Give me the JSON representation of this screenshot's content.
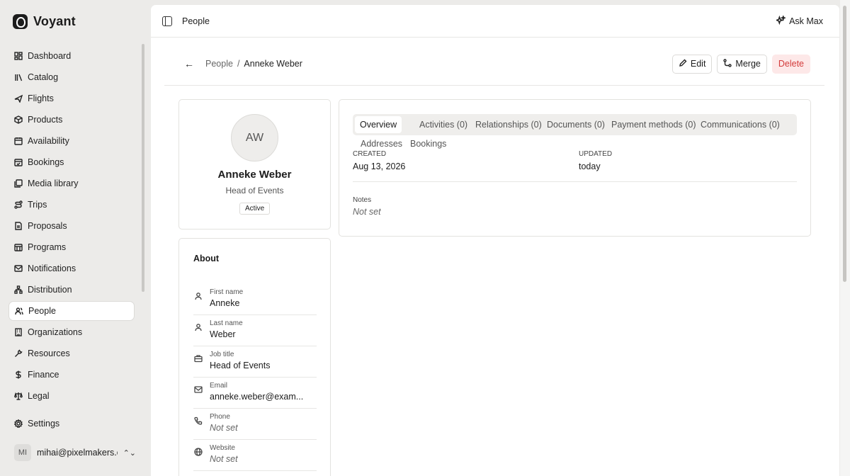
{
  "app": {
    "brand": "Voyant"
  },
  "sidebar": {
    "items": [
      {
        "label": "Dashboard",
        "icon": "dashboard-icon"
      },
      {
        "label": "Catalog",
        "icon": "catalog-icon"
      },
      {
        "label": "Flights",
        "icon": "plane-icon"
      },
      {
        "label": "Products",
        "icon": "box-icon"
      },
      {
        "label": "Availability",
        "icon": "calendar-icon"
      },
      {
        "label": "Bookings",
        "icon": "calendar-check-icon"
      },
      {
        "label": "Media library",
        "icon": "image-icon"
      },
      {
        "label": "Trips",
        "icon": "route-icon"
      },
      {
        "label": "Proposals",
        "icon": "file-icon"
      },
      {
        "label": "Programs",
        "icon": "calendar-grid-icon"
      },
      {
        "label": "Notifications",
        "icon": "mail-icon"
      },
      {
        "label": "Distribution",
        "icon": "network-icon"
      },
      {
        "label": "People",
        "icon": "users-icon",
        "active": true
      },
      {
        "label": "Organizations",
        "icon": "building-icon"
      },
      {
        "label": "Resources",
        "icon": "wrench-icon"
      },
      {
        "label": "Finance",
        "icon": "dollar-icon"
      },
      {
        "label": "Legal",
        "icon": "scale-icon"
      }
    ],
    "settings": "Settings",
    "user": {
      "initials": "MI",
      "email": "mihai@pixelmakers.c..."
    }
  },
  "topbar": {
    "title": "People",
    "ask": "Ask Max"
  },
  "breadcrumb": {
    "parent": "People",
    "separator": "/",
    "current": "Anneke Weber"
  },
  "actions": {
    "edit": "Edit",
    "merge": "Merge",
    "delete": "Delete"
  },
  "profile": {
    "initials": "AW",
    "name": "Anneke Weber",
    "role": "Head of Events",
    "status": "Active"
  },
  "about": {
    "title": "About",
    "fields": [
      {
        "label": "First name",
        "value": "Anneke",
        "icon": "user-icon"
      },
      {
        "label": "Last name",
        "value": "Weber",
        "icon": "user-icon"
      },
      {
        "label": "Job title",
        "value": "Head of Events",
        "icon": "briefcase-icon"
      },
      {
        "label": "Email",
        "value": "anneke.weber@exam...",
        "icon": "mail-icon"
      },
      {
        "label": "Phone",
        "value": "Not set",
        "icon": "phone-icon"
      },
      {
        "label": "Website",
        "value": "Not set",
        "icon": "globe-icon"
      }
    ]
  },
  "tabs": [
    "Overview",
    "Activities (0)",
    "Relationships (0)",
    "Documents (0)",
    "Payment methods (0)",
    "Communications (0)",
    "Addresses",
    "Bookings"
  ],
  "overview": {
    "created_label": "CREATED",
    "created_value": "Aug 13, 2026",
    "updated_label": "UPDATED",
    "updated_value": "today",
    "notes_label": "Notes",
    "notes_value": "Not set"
  }
}
